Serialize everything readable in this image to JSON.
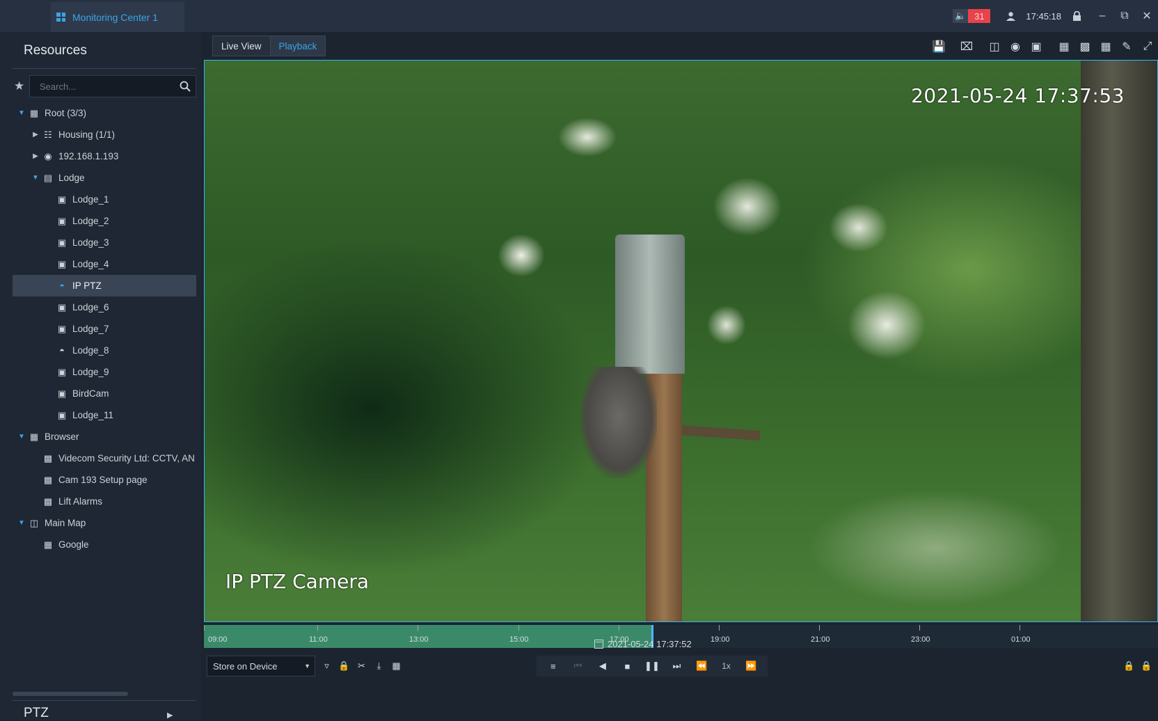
{
  "titlebar": {
    "tab_label": "Monitoring Center 1",
    "alarm_count": "31",
    "time": "17:45:18"
  },
  "sidebar": {
    "title": "Resources",
    "search_placeholder": "Search...",
    "tree": {
      "root": "Root (3/3)",
      "housing": "Housing (1/1)",
      "ip": "192.168.1.193",
      "lodge": "Lodge",
      "lodge_1": "Lodge_1",
      "lodge_2": "Lodge_2",
      "lodge_3": "Lodge_3",
      "lodge_4": "Lodge_4",
      "ip_ptz": "IP PTZ",
      "lodge_6": "Lodge_6",
      "lodge_7": "Lodge_7",
      "lodge_8": "Lodge_8",
      "lodge_9": "Lodge_9",
      "birdcam": "BirdCam",
      "lodge_11": "Lodge_11",
      "browser": "Browser",
      "videcom": "Videcom Security Ltd: CCTV, AN",
      "cam193": "Cam 193 Setup page",
      "lift": "Lift Alarms",
      "main_map": "Main Map",
      "google": "Google"
    },
    "ptz_label": "PTZ"
  },
  "main": {
    "tabs": [
      "Live View",
      "Playback"
    ],
    "active_tab": "Playback",
    "video": {
      "osd_timestamp": "2021-05-24 17:37:53",
      "osd_camera_name": "IP PTZ Camera"
    },
    "timeline": {
      "labels": [
        "09:00",
        "11:00",
        "13:00",
        "15:00",
        "17:00",
        "19:00",
        "21:00",
        "23:00",
        "01:00"
      ],
      "current": "2021-05-24 17:37:52"
    },
    "controls": {
      "store_option": "Store on Device",
      "speed": "1x"
    }
  },
  "colors": {
    "accent": "#3da3e6",
    "alarm": "#e8424a",
    "recording": "#3a8a6a",
    "video_border": "#33b7f2"
  }
}
